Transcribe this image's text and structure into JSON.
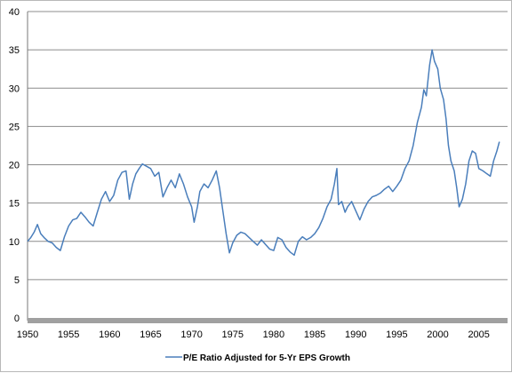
{
  "chart_data": {
    "type": "line",
    "title": "",
    "xlabel": "",
    "ylabel": "",
    "xlim": [
      1950,
      2008.5
    ],
    "ylim": [
      0,
      40
    ],
    "grid": true,
    "legend_position": "bottom",
    "x_ticks": [
      1950,
      1955,
      1960,
      1965,
      1970,
      1975,
      1980,
      1985,
      1990,
      1995,
      2000,
      2005
    ],
    "y_ticks": [
      0,
      5,
      10,
      15,
      20,
      25,
      30,
      35,
      40
    ],
    "series": [
      {
        "name": "P/E Ratio Adjusted for 5-Yr EPS Growth",
        "color": "#4a7ebb",
        "points": [
          [
            1950.0,
            10.0
          ],
          [
            1950.4,
            10.5
          ],
          [
            1950.8,
            11.2
          ],
          [
            1951.2,
            12.2
          ],
          [
            1951.6,
            11.0
          ],
          [
            1952.0,
            10.5
          ],
          [
            1952.5,
            10.0
          ],
          [
            1953.0,
            9.8
          ],
          [
            1953.5,
            9.2
          ],
          [
            1954.0,
            8.8
          ],
          [
            1954.5,
            10.6
          ],
          [
            1955.0,
            12.0
          ],
          [
            1955.5,
            12.8
          ],
          [
            1956.0,
            13.0
          ],
          [
            1956.5,
            13.8
          ],
          [
            1957.0,
            13.2
          ],
          [
            1957.5,
            12.5
          ],
          [
            1958.0,
            12.0
          ],
          [
            1958.5,
            13.8
          ],
          [
            1959.0,
            15.5
          ],
          [
            1959.5,
            16.5
          ],
          [
            1960.0,
            15.2
          ],
          [
            1960.5,
            16.0
          ],
          [
            1961.0,
            18.0
          ],
          [
            1961.5,
            19.0
          ],
          [
            1962.0,
            19.2
          ],
          [
            1962.4,
            15.5
          ],
          [
            1962.8,
            17.5
          ],
          [
            1963.2,
            18.8
          ],
          [
            1963.6,
            19.5
          ],
          [
            1964.0,
            20.1
          ],
          [
            1964.5,
            19.8
          ],
          [
            1965.0,
            19.5
          ],
          [
            1965.5,
            18.5
          ],
          [
            1966.0,
            19.0
          ],
          [
            1966.5,
            15.8
          ],
          [
            1967.0,
            17.0
          ],
          [
            1967.5,
            18.0
          ],
          [
            1968.0,
            17.0
          ],
          [
            1968.5,
            18.8
          ],
          [
            1969.0,
            17.5
          ],
          [
            1969.5,
            15.8
          ],
          [
            1970.0,
            14.5
          ],
          [
            1970.3,
            12.5
          ],
          [
            1970.7,
            14.5
          ],
          [
            1971.0,
            16.5
          ],
          [
            1971.5,
            17.5
          ],
          [
            1972.0,
            17.0
          ],
          [
            1972.5,
            18.0
          ],
          [
            1973.0,
            19.2
          ],
          [
            1973.4,
            17.0
          ],
          [
            1973.8,
            14.0
          ],
          [
            1974.2,
            11.0
          ],
          [
            1974.6,
            8.5
          ],
          [
            1975.0,
            9.8
          ],
          [
            1975.5,
            10.8
          ],
          [
            1976.0,
            11.2
          ],
          [
            1976.5,
            11.0
          ],
          [
            1977.0,
            10.5
          ],
          [
            1977.5,
            10.0
          ],
          [
            1978.0,
            9.5
          ],
          [
            1978.5,
            10.2
          ],
          [
            1979.0,
            9.6
          ],
          [
            1979.5,
            9.0
          ],
          [
            1980.0,
            8.8
          ],
          [
            1980.5,
            10.5
          ],
          [
            1981.0,
            10.2
          ],
          [
            1981.5,
            9.2
          ],
          [
            1982.0,
            8.6
          ],
          [
            1982.5,
            8.2
          ],
          [
            1983.0,
            10.0
          ],
          [
            1983.5,
            10.6
          ],
          [
            1984.0,
            10.2
          ],
          [
            1984.5,
            10.5
          ],
          [
            1985.0,
            11.0
          ],
          [
            1985.5,
            11.8
          ],
          [
            1986.0,
            13.0
          ],
          [
            1986.5,
            14.5
          ],
          [
            1987.0,
            15.5
          ],
          [
            1987.4,
            17.5
          ],
          [
            1987.7,
            19.5
          ],
          [
            1987.9,
            14.8
          ],
          [
            1988.3,
            15.2
          ],
          [
            1988.7,
            13.8
          ],
          [
            1989.0,
            14.5
          ],
          [
            1989.5,
            15.2
          ],
          [
            1990.0,
            14.0
          ],
          [
            1990.5,
            12.8
          ],
          [
            1991.0,
            14.2
          ],
          [
            1991.5,
            15.2
          ],
          [
            1992.0,
            15.8
          ],
          [
            1992.5,
            16.0
          ],
          [
            1993.0,
            16.3
          ],
          [
            1993.5,
            16.8
          ],
          [
            1994.0,
            17.2
          ],
          [
            1994.5,
            16.5
          ],
          [
            1995.0,
            17.2
          ],
          [
            1995.5,
            18.0
          ],
          [
            1996.0,
            19.5
          ],
          [
            1996.5,
            20.5
          ],
          [
            1997.0,
            22.5
          ],
          [
            1997.5,
            25.5
          ],
          [
            1998.0,
            27.5
          ],
          [
            1998.3,
            29.8
          ],
          [
            1998.6,
            29.0
          ],
          [
            1999.0,
            33.0
          ],
          [
            1999.3,
            35.0
          ],
          [
            1999.6,
            33.5
          ],
          [
            2000.0,
            32.5
          ],
          [
            2000.3,
            30.0
          ],
          [
            2000.7,
            28.5
          ],
          [
            2001.0,
            26.0
          ],
          [
            2001.3,
            22.5
          ],
          [
            2001.6,
            20.5
          ],
          [
            2002.0,
            19.2
          ],
          [
            2002.3,
            17.0
          ],
          [
            2002.6,
            14.5
          ],
          [
            2003.0,
            15.5
          ],
          [
            2003.4,
            17.5
          ],
          [
            2003.8,
            20.5
          ],
          [
            2004.2,
            21.8
          ],
          [
            2004.6,
            21.5
          ],
          [
            2005.0,
            19.5
          ],
          [
            2005.5,
            19.2
          ],
          [
            2006.0,
            18.8
          ],
          [
            2006.4,
            18.5
          ],
          [
            2006.8,
            20.5
          ],
          [
            2007.2,
            21.8
          ],
          [
            2007.5,
            23.0
          ]
        ]
      }
    ]
  }
}
